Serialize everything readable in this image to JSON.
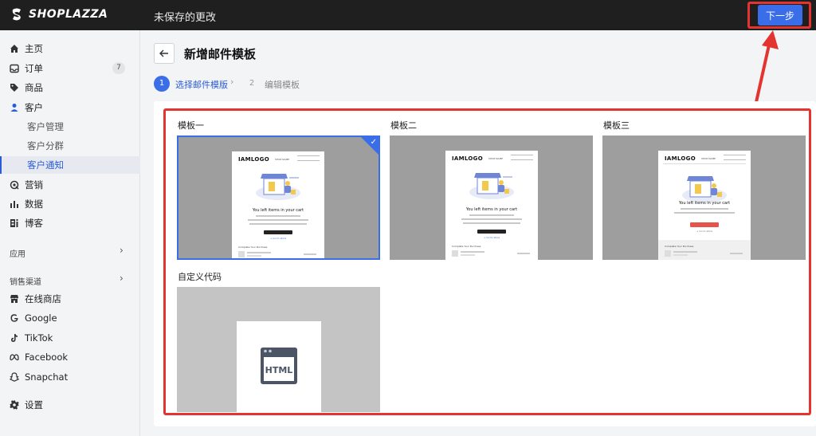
{
  "app": {
    "logo_text": "SHOPLAZZA",
    "unsaved_text": "未保存的更改",
    "next_label": "下一步"
  },
  "sidebar": {
    "items": [
      {
        "label": "主页",
        "icon": "home-icon"
      },
      {
        "label": "订单",
        "icon": "inbox-icon",
        "badge": "7"
      },
      {
        "label": "商品",
        "icon": "tag-icon"
      },
      {
        "label": "客户",
        "icon": "person-icon"
      },
      {
        "label": "客户管理"
      },
      {
        "label": "客户分群"
      },
      {
        "label": "客户通知",
        "active": true
      },
      {
        "label": "营销",
        "icon": "megaphone-icon"
      },
      {
        "label": "数据",
        "icon": "bar-chart-icon"
      },
      {
        "label": "博客",
        "icon": "blog-icon"
      }
    ],
    "apps_title": "应用",
    "channels_title": "销售渠道",
    "channels": [
      {
        "label": "在线商店",
        "icon": "store-icon"
      },
      {
        "label": "Google",
        "icon": "google-icon"
      },
      {
        "label": "TikTok",
        "icon": "tiktok-icon"
      },
      {
        "label": "Facebook",
        "icon": "facebook-icon"
      },
      {
        "label": "Snapchat",
        "icon": "snapchat-icon"
      }
    ],
    "settings": {
      "label": "设置",
      "icon": "gear-icon"
    }
  },
  "page": {
    "title": "新增邮件模板",
    "steps": [
      {
        "num": "1",
        "label": "选择邮件模版",
        "active": true
      },
      {
        "num": "2",
        "label": "编辑模板",
        "active": false
      }
    ]
  },
  "templates": [
    {
      "label": "模板一",
      "selected": true
    },
    {
      "label": "模板二",
      "selected": false
    },
    {
      "label": "模板三",
      "selected": false
    },
    {
      "label": "自定义代码",
      "selected": false
    }
  ],
  "email_preview": {
    "logo": "IAMLOGO",
    "shop_name": "SHOP NAME",
    "headline": "You left items in your cart",
    "footer_title": "Complete Your Purchase",
    "link_text": "+ Go to store",
    "html_label": "HTML"
  },
  "colors": {
    "accent": "#3a6ee8",
    "highlight": "#e3342f",
    "topbar": "#1f1f1f"
  }
}
